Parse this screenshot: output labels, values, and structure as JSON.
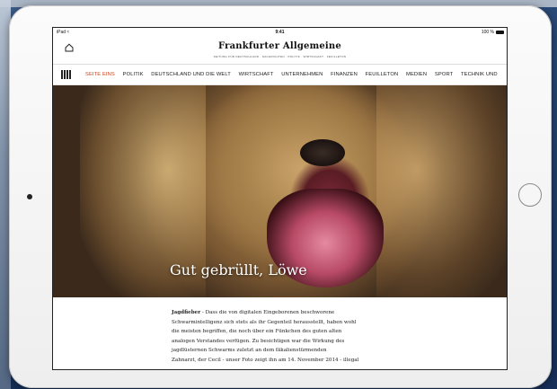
{
  "statusbar": {
    "left": "iPad ≈",
    "time": "9:41",
    "right": "100 %"
  },
  "masthead": {
    "logo": "Frankfurter Allgemeine",
    "tagline": "ZEITUNG FÜR DEUTSCHLAND · NACHRICHTEN · POLITIK · WIRTSCHAFT · FEUILLETON"
  },
  "nav": {
    "items": [
      {
        "label": "SEITE EINS",
        "active": true
      },
      {
        "label": "POLITIK"
      },
      {
        "label": "DEUTSCHLAND UND DIE WELT"
      },
      {
        "label": "WIRTSCHAFT"
      },
      {
        "label": "UNTERNEHMEN"
      },
      {
        "label": "FINANZEN"
      },
      {
        "label": "FEUILLETON"
      },
      {
        "label": "MEDIEN"
      },
      {
        "label": "SPORT"
      },
      {
        "label": "TECHNIK UND"
      }
    ]
  },
  "hero": {
    "title": "Gut gebrüllt, Löwe"
  },
  "article": {
    "lead": "Jagdfieber",
    "lines": [
      " - Dass die von digitalen Eingeborenen beschworene",
      "Schwarmintelligenz sich stets als ihr Gegenteil herausstellt, haben wohl",
      "die meisten begriffen, die noch über ein Fünkchen des guten alten",
      "analogen Verstandes verfügen. Zu besichtigen war die Wirkung des",
      "jagdlüsternen Schwarms zuletzt an dem fäkalienstürmenden",
      "Zahnarzt, der Cecil - unser Foto zeigt ihn am 14. November 2014 - illegal"
    ]
  },
  "colors": {
    "accent": "#c8451e",
    "device_frame": "#f4f4f4",
    "backdrop": "#1d3557"
  }
}
